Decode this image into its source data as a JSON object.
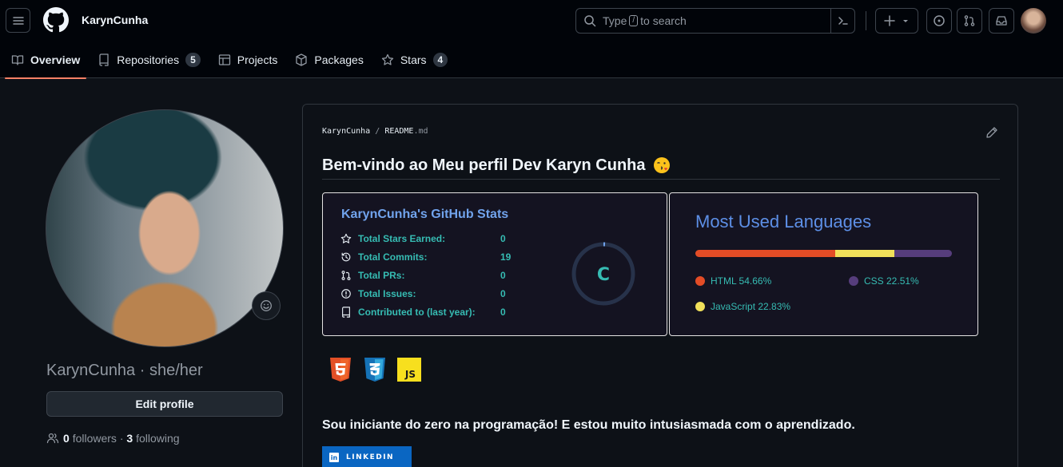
{
  "header": {
    "username": "KarynCunha",
    "search": {
      "placeholder_before": "Type",
      "placeholder_key": "/",
      "placeholder_after": "to search"
    }
  },
  "tabs": [
    {
      "label": "Overview",
      "icon": "book-icon",
      "active": true
    },
    {
      "label": "Repositories",
      "icon": "repo-icon",
      "count": "5"
    },
    {
      "label": "Projects",
      "icon": "table-icon"
    },
    {
      "label": "Packages",
      "icon": "package-icon"
    },
    {
      "label": "Stars",
      "icon": "star-icon",
      "count": "4"
    }
  ],
  "profile": {
    "nickname": "KarynCunha · she/her",
    "edit_label": "Edit profile",
    "followers_count": "0",
    "followers_label": "followers",
    "following_count": "3",
    "following_label": "following",
    "dot": "·"
  },
  "readme": {
    "crumb_user": "KarynCunha",
    "crumb_sep": "/",
    "crumb_file": "README",
    "crumb_ext": ".md",
    "title": "Bem-vindo ao Meu perfil Dev Karyn Cunha",
    "intro": "Sou iniciante do zero na programação! E estou muito intusiasmada com o aprendizado.",
    "linkedin_label": "LINKEDIN"
  },
  "stats": {
    "title": "KarynCunha's GitHub Stats",
    "rows": [
      {
        "label": "Total Stars Earned:",
        "value": "0",
        "icon": "star-icon"
      },
      {
        "label": "Total Commits:",
        "value": "19",
        "icon": "history-icon"
      },
      {
        "label": "Total PRs:",
        "value": "0",
        "icon": "pull-request-icon"
      },
      {
        "label": "Total Issues:",
        "value": "0",
        "icon": "issue-icon"
      },
      {
        "label": "Contributed to (last year):",
        "value": "0",
        "icon": "repo-icon"
      }
    ],
    "grade": "C",
    "colors": {
      "title": "#71a3ec",
      "text": "#36bcb3",
      "bg": "#141321"
    }
  },
  "languages": {
    "title": "Most Used Languages",
    "items": [
      {
        "label": "HTML 54.66%",
        "percent": 54.66,
        "color": "#e34c26"
      },
      {
        "label": "CSS 22.51%",
        "percent": 22.51,
        "color": "#563d7c"
      },
      {
        "label": "JavaScript 22.83%",
        "percent": 22.83,
        "color": "#f1e05a"
      }
    ]
  },
  "badges": [
    {
      "name": "html5-icon",
      "text": "5",
      "color": "#e34f26"
    },
    {
      "name": "css3-icon",
      "text": "3",
      "color": "#1572b6"
    },
    {
      "name": "javascript-icon",
      "text": "JS",
      "color": "#f7df1e"
    }
  ]
}
